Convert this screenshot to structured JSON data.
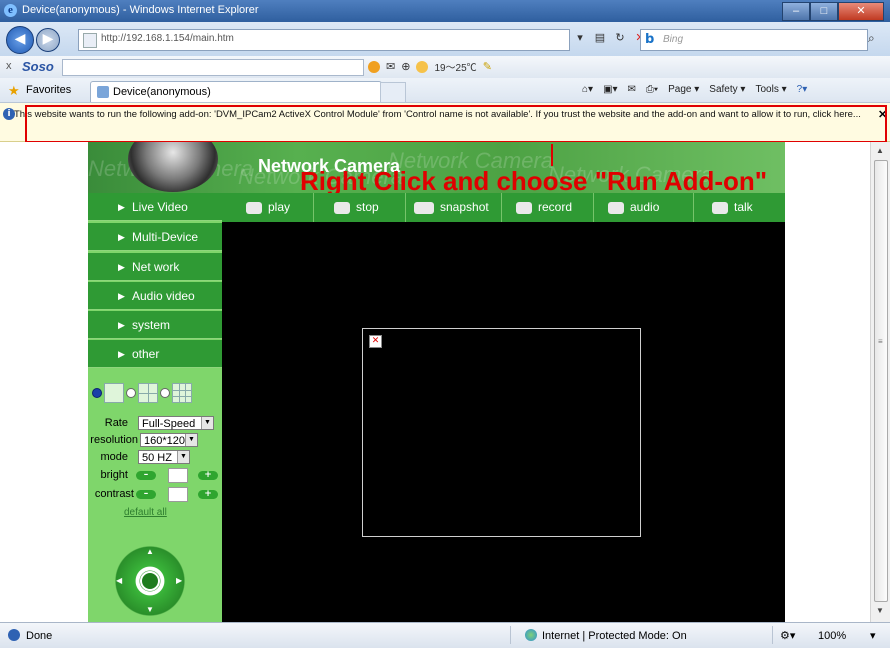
{
  "window": {
    "title": "Device(anonymous) - Windows Internet Explorer"
  },
  "address_bar": {
    "url": "http://192.168.1.154/main.htm",
    "search_placeholder": "Bing"
  },
  "soso_toolbar": {
    "logo": "Soso",
    "weather": "19～25℃"
  },
  "favorites_bar": {
    "favorites_label": "Favorites",
    "tab_title": "Device(anonymous)"
  },
  "command_bar": {
    "page": "Page",
    "safety": "Safety",
    "tools": "Tools"
  },
  "infobar": {
    "message": "This website wants to run the following add-on: 'DVM_IPCam2 ActiveX Control Module' from 'Control name is not available'. If you trust the website and the add-on and want to allow it to run, click here..."
  },
  "annotation": {
    "text": "Right Click and choose \"Run Add-on\"",
    "color": "#e00000"
  },
  "camera": {
    "brand": "Network Camera",
    "watermark": "Network Camera",
    "menu": [
      "Live Video",
      "Multi-Device",
      "Net work",
      "Audio video",
      "system",
      "other"
    ],
    "toolbar": [
      "play",
      "stop",
      "snapshot",
      "record",
      "audio",
      "talk"
    ],
    "controls": {
      "rate_label": "Rate",
      "rate_value": "Full-Speed",
      "resolution_label": "resolution",
      "resolution_value": "160*120",
      "mode_label": "mode",
      "mode_value": "50 HZ",
      "bright_label": "bright",
      "contrast_label": "contrast",
      "default_all": "default all"
    },
    "colors": {
      "green": "#2f9a34",
      "panel": "#7fd66b"
    }
  },
  "status_bar": {
    "status": "Done",
    "zone": "Internet | Protected Mode: On",
    "zoom": "100%"
  }
}
